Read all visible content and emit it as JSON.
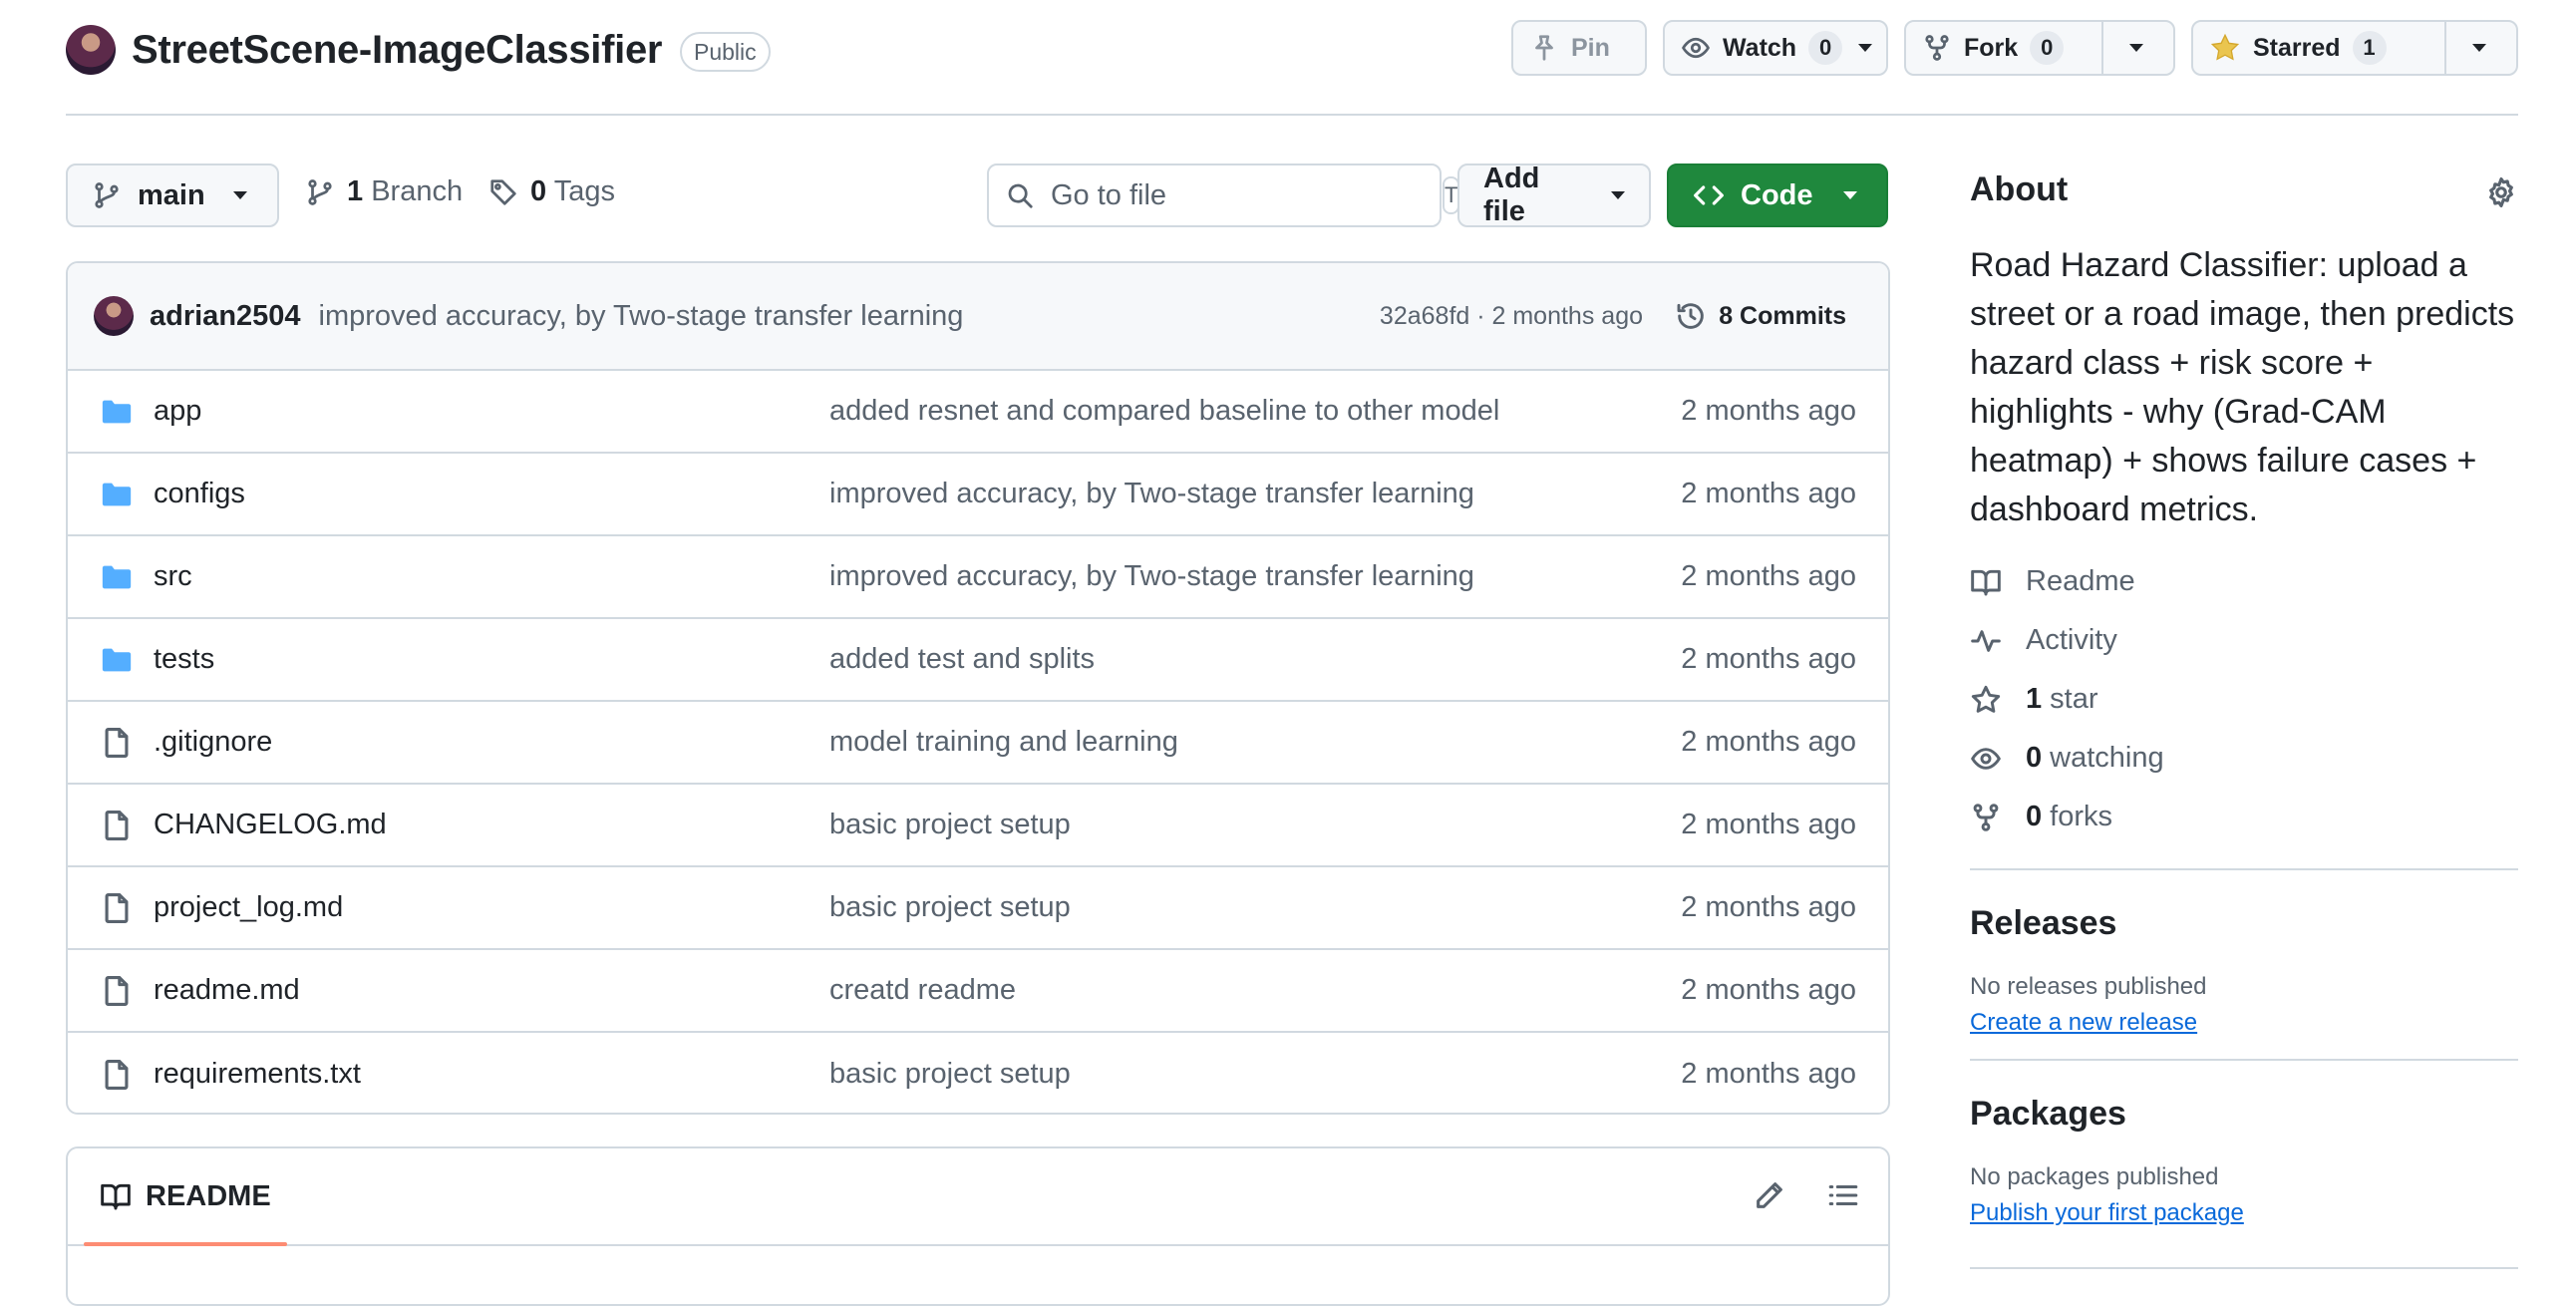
{
  "repo": {
    "name": "StreetScene-ImageClassifier",
    "visibility": "Public"
  },
  "header_actions": {
    "pin_label": "Pin",
    "watch_label": "Watch",
    "watch_count": "0",
    "fork_label": "Fork",
    "fork_count": "0",
    "star_label": "Starred",
    "star_count": "1"
  },
  "toolbar": {
    "branch": "main",
    "branch_count": "1",
    "branch_label": "Branch",
    "tag_count": "0",
    "tag_label": "Tags",
    "search_placeholder": "Go to file",
    "search_shortcut": "T",
    "add_file_label": "Add file",
    "code_label": "Code"
  },
  "latest_commit": {
    "author": "adrian2504",
    "message": "improved accuracy, by Two-stage transfer learning",
    "hash_and_time": "32a68fd · 2 months ago",
    "commits_label": "8 Commits"
  },
  "files": [
    {
      "name": "app",
      "type": "folder",
      "message": "added resnet and compared baseline to other model",
      "date": "2 months ago"
    },
    {
      "name": "configs",
      "type": "folder",
      "message": "improved accuracy, by Two-stage transfer learning",
      "date": "2 months ago"
    },
    {
      "name": "src",
      "type": "folder",
      "message": "improved accuracy, by Two-stage transfer learning",
      "date": "2 months ago"
    },
    {
      "name": "tests",
      "type": "folder",
      "message": "added test and splits",
      "date": "2 months ago"
    },
    {
      "name": ".gitignore",
      "type": "file",
      "message": "model training and learning",
      "date": "2 months ago"
    },
    {
      "name": "CHANGELOG.md",
      "type": "file",
      "message": "basic project setup",
      "date": "2 months ago"
    },
    {
      "name": "project_log.md",
      "type": "file",
      "message": "basic project setup",
      "date": "2 months ago"
    },
    {
      "name": "readme.md",
      "type": "file",
      "message": "creatd readme",
      "date": "2 months ago"
    },
    {
      "name": "requirements.txt",
      "type": "file",
      "message": "basic project setup",
      "date": "2 months ago"
    }
  ],
  "readme_panel": {
    "tab_label": "README"
  },
  "about": {
    "title": "About",
    "description": "Road Hazard Classifier: upload a street or a road image, then predicts hazard class + risk score + highlights - why (Grad-CAM heatmap) + shows failure cases + dashboard metrics.",
    "readme_label": "Readme",
    "activity_label": "Activity",
    "stars_count": "1",
    "stars_label": "star",
    "watching_count": "0",
    "watching_label": "watching",
    "forks_count": "0",
    "forks_label": "forks"
  },
  "releases": {
    "title": "Releases",
    "note": "No releases published",
    "link": "Create a new release"
  },
  "packages": {
    "title": "Packages",
    "note": "No packages published",
    "link": "Publish your first package"
  },
  "colors": {
    "code_button": "#1f883d",
    "link": "#0969da",
    "folder_icon": "#54aeff",
    "star_icon": "#eac54f",
    "tab_underline": "#fd8c73"
  }
}
